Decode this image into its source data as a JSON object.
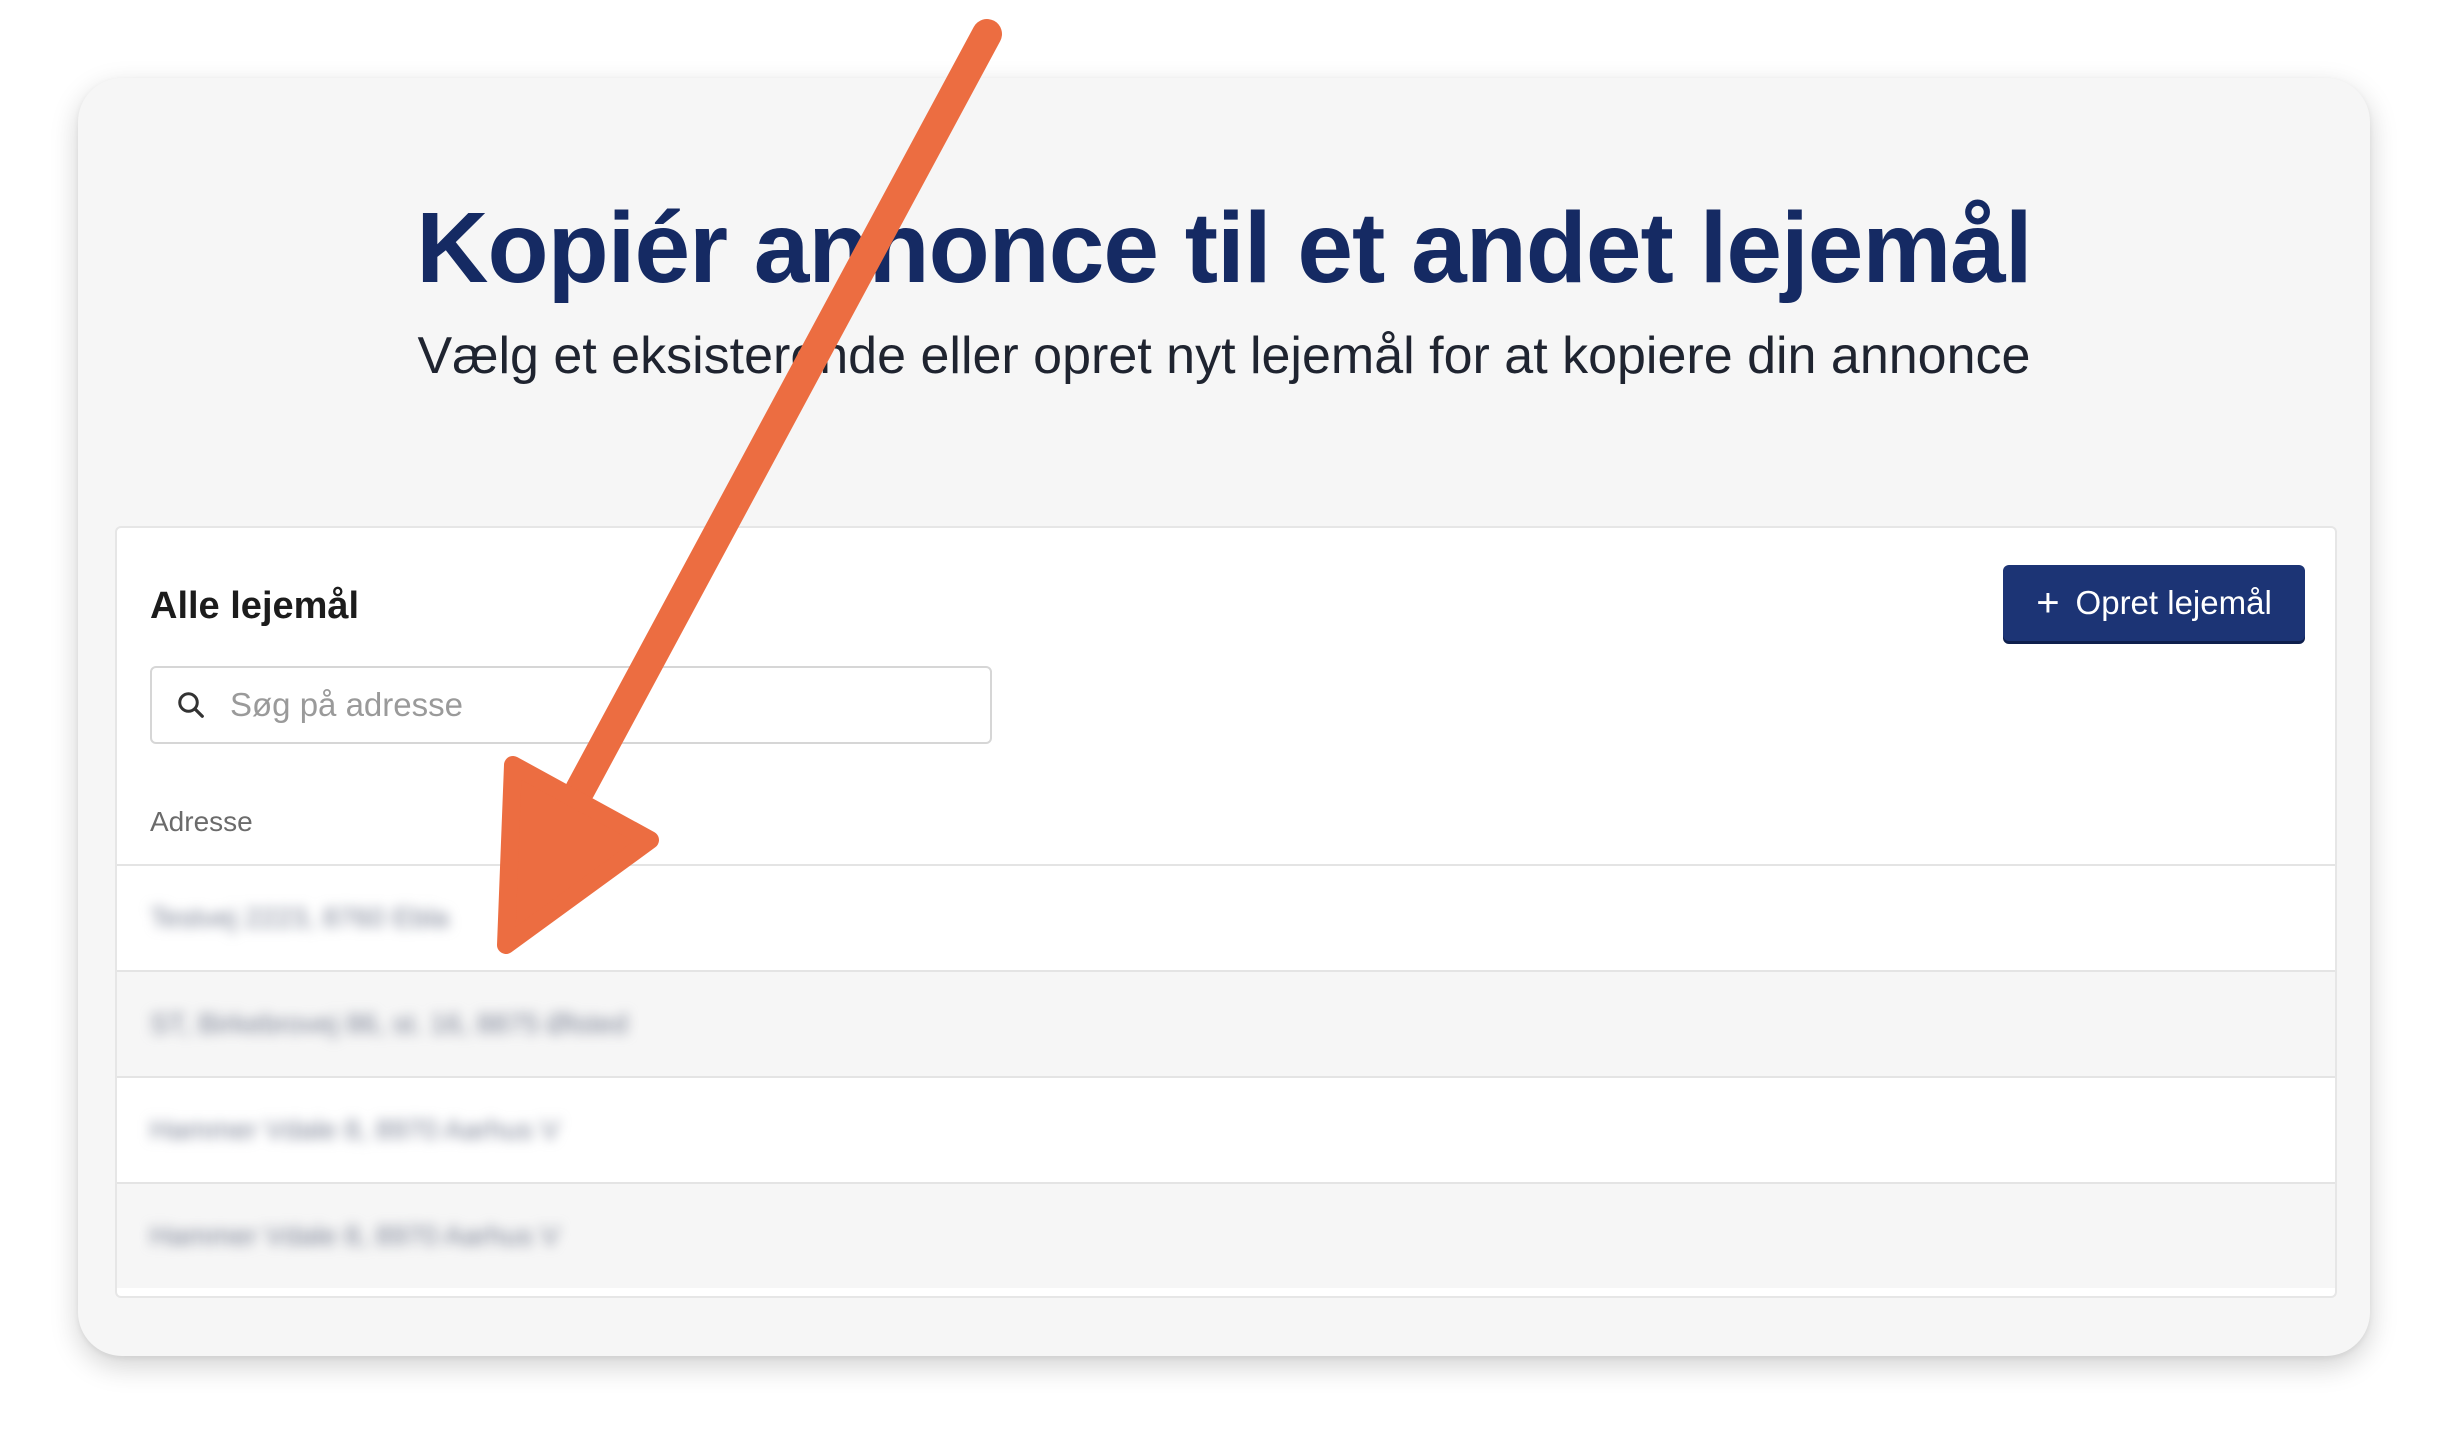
{
  "dialog": {
    "title": "Kopiér annonce til et andet lejemål",
    "subtitle": "Vælg et eksisterende eller opret nyt lejemål for at kopiere din annonce"
  },
  "panel": {
    "title": "Alle lejemål",
    "create_button_label": "Opret lejemål",
    "search": {
      "placeholder": "Søg på adresse",
      "value": ""
    },
    "column_header": "Adresse",
    "rows": [
      {
        "address": "Testvej 2223, 8760 Ebla"
      },
      {
        "address": "ST, Birkebrovej 86, st. 16, 8875 Ølsted"
      },
      {
        "address": "Hammer Vdale 8, 8970 Aarhus V"
      },
      {
        "address": "Hammer Vdale 8, 8970 Aarhus V"
      }
    ]
  },
  "annotation": {
    "arrow_color": "#ec6d41"
  },
  "colors": {
    "heading": "#152a63",
    "button": "#1c3475",
    "card_bg": "#f6f6f6"
  }
}
